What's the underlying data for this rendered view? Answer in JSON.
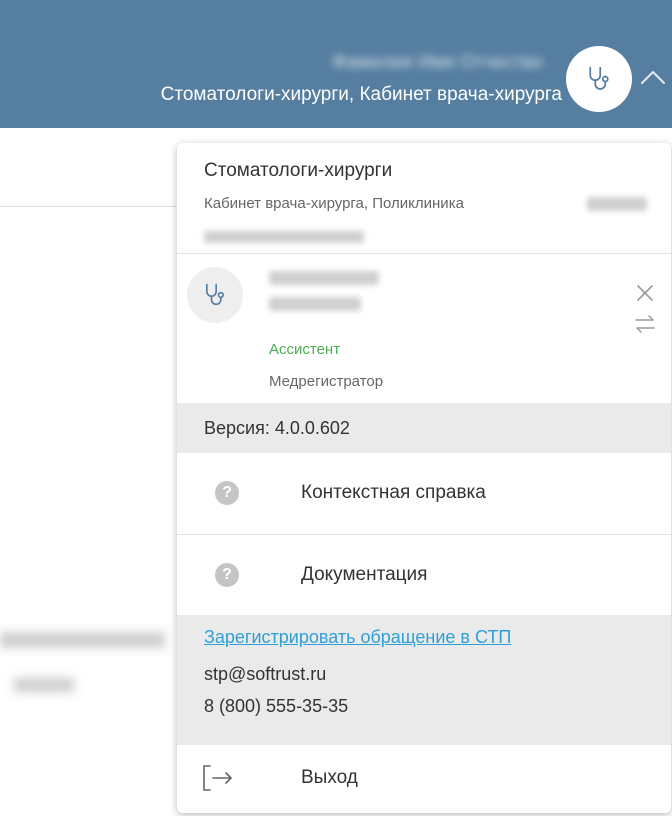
{
  "header": {
    "user_name": "Фамилия Имя Отчество",
    "department": "Стоматологи-хирурги, Кабинет врача-хирурга",
    "avatar_icon": "stethoscope-icon",
    "chevron_icon": "chevron-up-icon",
    "background_color": "#557ea0"
  },
  "menu": {
    "org": {
      "title": "Стоматологи-хирурги",
      "subtitle": "Кабинет врача-хирурга, Поликлиника"
    },
    "role": {
      "avatar_icon": "stethoscope-icon",
      "active_role": "Ассистент",
      "other_role": "Медрегистратор",
      "active_color": "#4caf50"
    },
    "version": "Версия: 4.0.0.602",
    "items": [
      {
        "label": "Контекстная справка",
        "icon": "help-circle-icon"
      },
      {
        "label": "Документация",
        "icon": "help-circle-icon"
      }
    ],
    "support": {
      "link_text": "Зарегистрировать обращение в СТП",
      "email": "stp@softrust.ru",
      "phone": "8 (800) 555-35-35",
      "link_color": "#2f9fd8"
    },
    "logout": {
      "label": "Выход",
      "icon": "logout-icon"
    }
  }
}
